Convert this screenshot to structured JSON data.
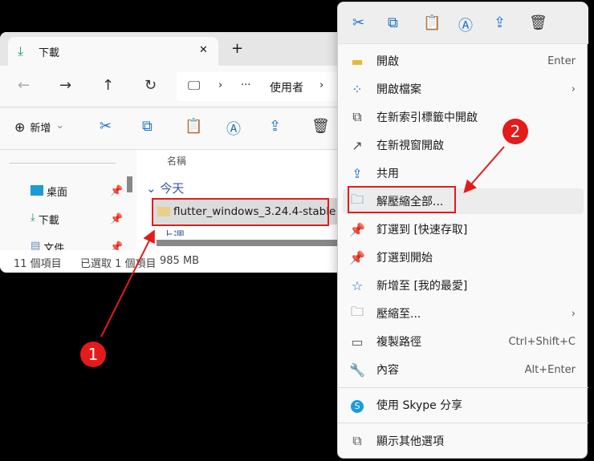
{
  "explorer": {
    "tab_title": "下載",
    "close": "✕",
    "new_tab": "+",
    "breadcrumb": {
      "more": "···",
      "folder": "使用者"
    },
    "new_label": "新增",
    "column_name": "名稱",
    "group_today": "今天",
    "group_lastweek": "上週",
    "selected_file": "flutter_windows_3.24.4-stable",
    "sidebar": [
      {
        "label": "桌面"
      },
      {
        "label": "下載"
      },
      {
        "label": "文件"
      }
    ],
    "status": {
      "count": "11 個項目",
      "selected": "已選取 1 個項目",
      "size": "985 MB"
    }
  },
  "menu": {
    "items": [
      {
        "label": "開啟",
        "shortcut": "Enter",
        "icon": "folder-icon"
      },
      {
        "label": "開啟檔案",
        "shortcut": "›",
        "icon": "open-with-icon"
      },
      {
        "label": "在新索引標籤中開啟",
        "shortcut": "",
        "icon": "new-tab-icon"
      },
      {
        "label": "在新視窗開啟",
        "shortcut": "",
        "icon": "new-window-icon"
      },
      {
        "label": "共用",
        "shortcut": "",
        "icon": "share-icon"
      },
      {
        "label": "解壓縮全部...",
        "shortcut": "",
        "icon": "extract-icon"
      },
      {
        "label": "釘選到 [快速存取]",
        "shortcut": "",
        "icon": "pin-icon"
      },
      {
        "label": "釘選到開始",
        "shortcut": "",
        "icon": "pin-start-icon"
      },
      {
        "label": "新增至 [我的最愛]",
        "shortcut": "",
        "icon": "star-icon"
      },
      {
        "label": "壓縮至...",
        "shortcut": "›",
        "icon": "compress-icon"
      },
      {
        "label": "複製路徑",
        "shortcut": "Ctrl+Shift+C",
        "icon": "copy-path-icon"
      },
      {
        "label": "內容",
        "shortcut": "Alt+Enter",
        "icon": "properties-icon"
      },
      {
        "label": "使用 Skype 分享",
        "shortcut": "",
        "icon": "skype-icon"
      },
      {
        "label": "顯示其他選項",
        "shortcut": "",
        "icon": "more-options-icon"
      }
    ]
  },
  "annotations": {
    "step1": "1",
    "step2": "2",
    "color": "#e31b1b"
  }
}
